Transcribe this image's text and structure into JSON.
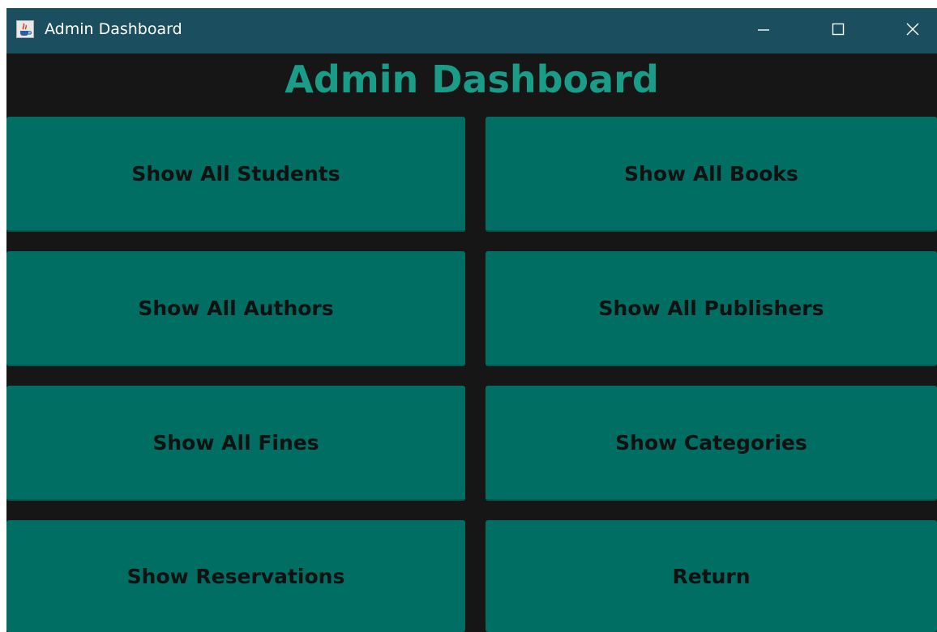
{
  "window": {
    "title": "Admin Dashboard",
    "icon": "java-cup-icon",
    "controls": {
      "minimize": "minimize-icon",
      "maximize": "maximize-icon",
      "close": "close-icon"
    }
  },
  "header": {
    "title": "Admin Dashboard"
  },
  "buttons": {
    "show_all_students": "Show All Students",
    "show_all_books": "Show All Books",
    "show_all_authors": "Show All Authors",
    "show_all_publishers": "Show All Publishers",
    "show_all_fines": "Show All Fines",
    "show_categories": "Show Categories",
    "show_reservations": "Show Reservations",
    "return": "Return"
  },
  "colors": {
    "titlebar": "#1b4f5f",
    "background": "#161616",
    "accent": "#1a9d88",
    "button": "#006e63",
    "button_text": "#111111"
  }
}
